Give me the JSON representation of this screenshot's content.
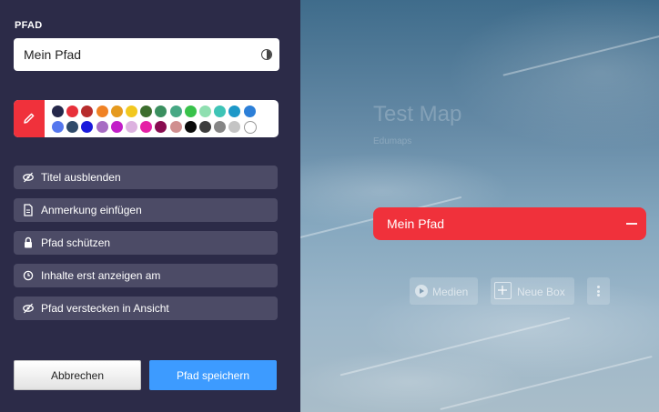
{
  "panel": {
    "title": "PFAD",
    "name_value": "Mein Pfad",
    "colors_row1": [
      "#25284a",
      "#e8303a",
      "#b72d2d",
      "#f08224",
      "#e59a1f",
      "#f2c81f",
      "#3d6e2e",
      "#3a8f5f",
      "#47a884",
      "#38c24a",
      "#8fdfb0",
      "#3ec4b6",
      "#1d98c8",
      "#2c7fd8"
    ],
    "colors_row2": [
      "#5577ee",
      "#2f4a6a",
      "#1a1adc",
      "#a76cc3",
      "#c21ec8",
      "#ddb2e0",
      "#e520a5",
      "#880c50",
      "#d08f8f",
      "#0a0a0a",
      "#3d3d3d",
      "#858585",
      "#c4c4c4",
      "#ffffff"
    ],
    "options": [
      {
        "label": "Titel ausblenden",
        "icon": "eye-slash-icon"
      },
      {
        "label": "Anmerkung einfügen",
        "icon": "document-icon"
      },
      {
        "label": "Pfad schützen",
        "icon": "lock-icon"
      },
      {
        "label": "Inhalte erst anzeigen am",
        "icon": "clock-icon"
      },
      {
        "label": "Pfad verstecken in Ansicht",
        "icon": "eye-slash-icon"
      }
    ],
    "cancel_label": "Abbrechen",
    "save_label": "Pfad speichern"
  },
  "map": {
    "title": "Test Map",
    "subtitle": "Edumaps",
    "path_card_label": "Mein Pfad",
    "media_label": "Medien",
    "new_box_label": "Neue Box"
  },
  "colors": {
    "panel_bg": "#2c2b48",
    "accent_red": "#f0313b",
    "save_blue": "#3d9bff",
    "option_bg": "#4c4b66"
  }
}
